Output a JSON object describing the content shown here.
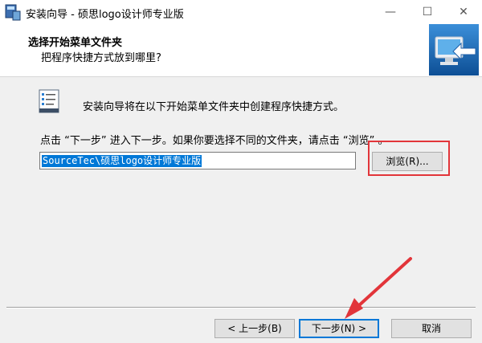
{
  "window": {
    "title": "安装向导 - 硕思logo设计师专业版",
    "app_icon": "installer-icon",
    "min_glyph": "—",
    "max_glyph": "☐",
    "close_glyph": "✕"
  },
  "header": {
    "title": "选择开始菜单文件夹",
    "subtitle": "把程序快捷方式放到哪里?",
    "graphic_icon": "computer-arrow-icon"
  },
  "content": {
    "description": "安装向导将在以下开始菜单文件夹中创建程序快捷方式。",
    "instruction": "点击 “下一步” 进入下一步。如果你要选择不同的文件夹，请点击 “浏览” 。",
    "folder_path": "SourceTec\\硕思logo设计师专业版",
    "browse_label": "浏览(R)..."
  },
  "footer": {
    "back_label": "< 上一步(B)",
    "next_label": "下一步(N) >",
    "cancel_label": "取消"
  },
  "annotations": {
    "highlight_color": "#e2353a",
    "arrow_color": "#e2353a"
  }
}
